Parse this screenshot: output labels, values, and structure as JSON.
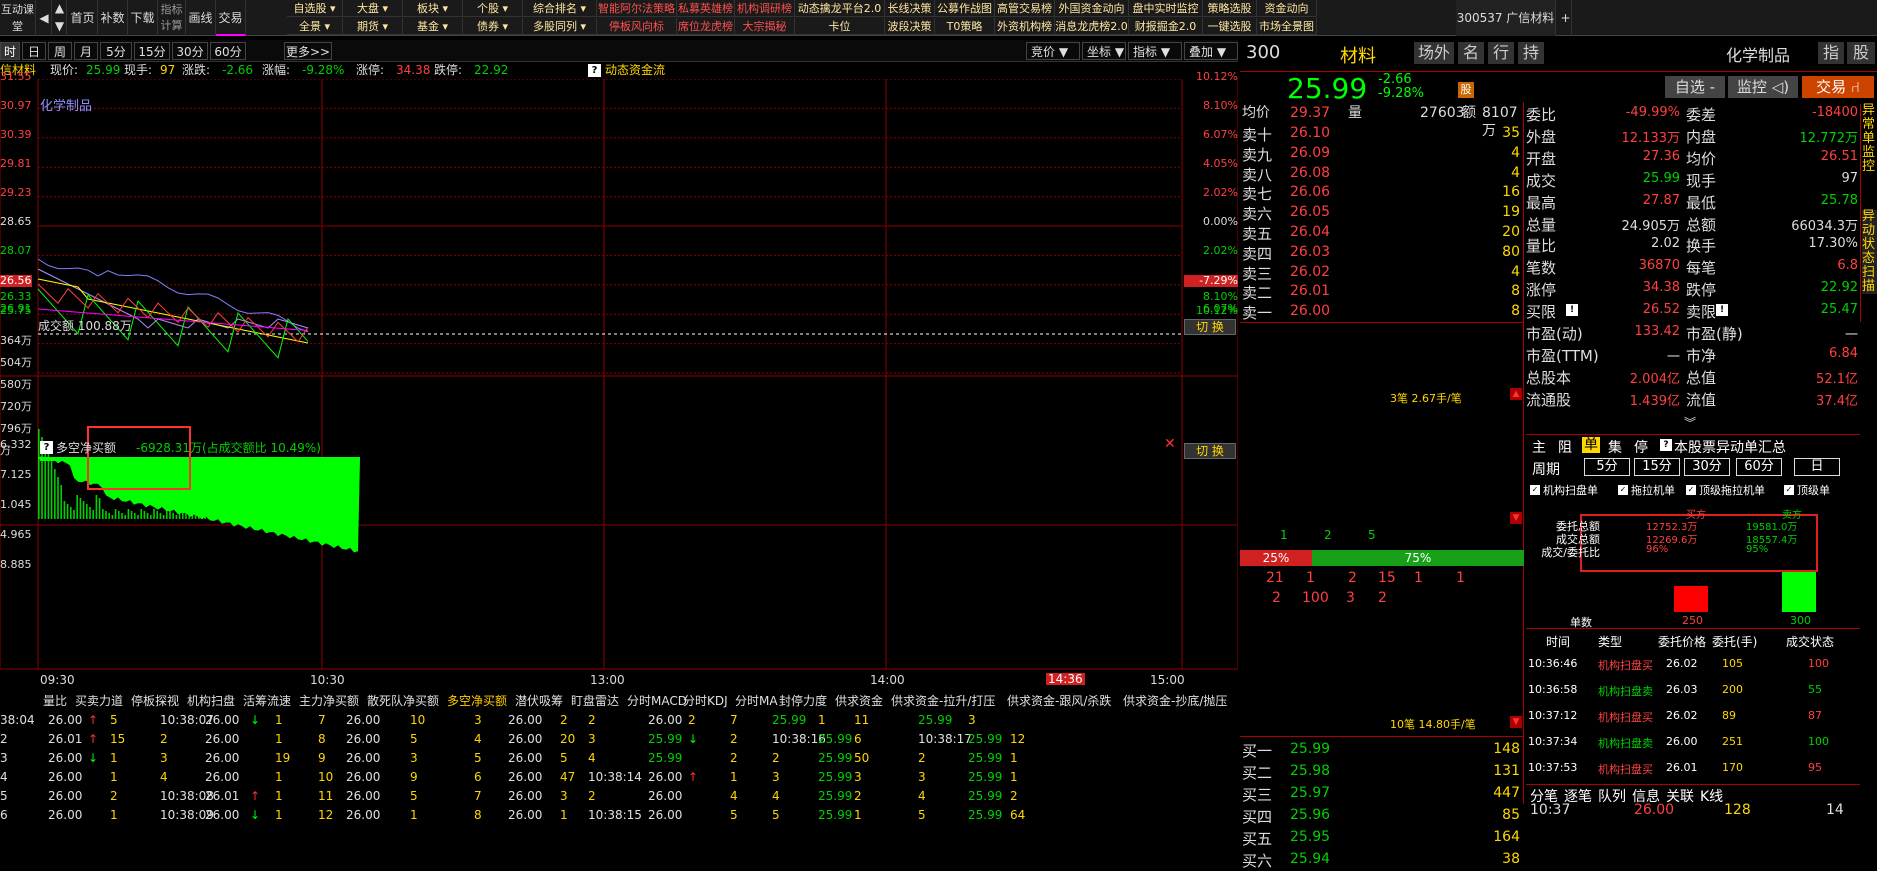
{
  "topbar": {
    "left_buttons": [
      "互动课堂",
      "首页",
      "补数",
      "下载",
      "指标计算",
      "画线",
      "交易"
    ],
    "row1": [
      {
        "t": "自选股",
        "c": "gw"
      },
      {
        "t": "大盘",
        "c": "gw"
      },
      {
        "t": "板块",
        "c": "gw"
      },
      {
        "t": "个股",
        "c": "gw"
      },
      {
        "t": "综合排名",
        "c": "gw"
      },
      {
        "t": "智能阿尔法策略",
        "c": "gr"
      },
      {
        "t": "私募英雄榜",
        "c": "gr"
      },
      {
        "t": "机构调研榜",
        "c": "gr"
      },
      {
        "t": "动态擒龙平台2.0",
        "c": "gw"
      },
      {
        "t": "长线决策",
        "c": "gw"
      },
      {
        "t": "公募作战图",
        "c": "gw"
      },
      {
        "t": "高管交易榜",
        "c": "gw"
      },
      {
        "t": "外国资金动向",
        "c": "gw"
      },
      {
        "t": "盘中实时监控",
        "c": "gw"
      },
      {
        "t": "策略选股",
        "c": "gw"
      },
      {
        "t": "资金动向",
        "c": "gw"
      }
    ],
    "row2": [
      {
        "t": "全景",
        "c": "gw"
      },
      {
        "t": "期货",
        "c": "gw"
      },
      {
        "t": "基金",
        "c": "gw"
      },
      {
        "t": "债券",
        "c": "gw"
      },
      {
        "t": "多股同列",
        "c": "gw"
      },
      {
        "t": "停板风向标",
        "c": "gr"
      },
      {
        "t": "席位龙虎榜",
        "c": "gr"
      },
      {
        "t": "大宗揭秘",
        "c": "gr"
      },
      {
        "t": "卡位",
        "c": "gw"
      },
      {
        "t": "波段决策",
        "c": "gw"
      },
      {
        "t": "T0策略",
        "c": "gw"
      },
      {
        "t": "外资机构榜",
        "c": "gw"
      },
      {
        "t": "消息龙虎榜2.0",
        "c": "gw"
      },
      {
        "t": "财报掘金2.0",
        "c": "gw"
      },
      {
        "t": "一键选股",
        "c": "gw"
      },
      {
        "t": "市场全景图",
        "c": "gw"
      }
    ],
    "tab_label": "300537 广信材料",
    "plus": "+"
  },
  "period": {
    "buttons": [
      "时",
      "日",
      "周",
      "月",
      "5分",
      "15分",
      "30分",
      "60分",
      "更多>>"
    ],
    "right": [
      "竞价",
      "坐标",
      "指标",
      "叠加"
    ]
  },
  "infobar": {
    "name": "信材料",
    "price_label": "现价:",
    "price": "25.99",
    "vol_label": "现手:",
    "vol": "97",
    "chg_label": "涨跌:",
    "chg": "-2.66",
    "pct_label": "涨幅:",
    "pct": "-9.28%",
    "limup_label": "涨停:",
    "limup": "34.38",
    "limdn_label": "跌停:",
    "limdn": "22.92",
    "flow": "动态资金流"
  },
  "chart": {
    "left_prices": [
      "31.55",
      "30.97",
      "30.39",
      "29.81",
      "29.23",
      "28.65",
      "28.07",
      "27.49",
      "26.91",
      "26.56",
      "26.33",
      "25.75"
    ],
    "right_pcts": [
      "10.12%",
      "8.10%",
      "6.07%",
      "4.05%",
      "2.02%",
      "0.00%",
      "2.02%",
      "4.05%",
      "6.07%",
      "-7.29%",
      "8.10%",
      "10.12%"
    ],
    "sector": "化学制品",
    "vol_title": "成交额 100.88万",
    "vol_left": [
      "364万",
      "504万",
      "580万",
      "720万",
      "796万",
      "万"
    ],
    "net_title": "多空净买额",
    "net_value": "-6928.31万(占成交额比 10.49%)",
    "net_left": [
      "6.332",
      "7.125",
      "1.045",
      "4.965",
      "8.885"
    ],
    "switch": "切 换",
    "times": [
      "09:30",
      "10:30",
      "13:00",
      "14:00",
      "15:00"
    ],
    "cur_time": "14:36",
    "colors": {
      "up": "#ff3030",
      "down": "#00ff00",
      "grid": "#8b0000"
    }
  },
  "right": {
    "code": "300",
    "name": "材料",
    "tags": [
      "场外",
      "名",
      "行",
      "持"
    ],
    "sector": "化学制品",
    "sector_tags": [
      "指",
      "股"
    ],
    "price": "25.99",
    "chg": "-2.66",
    "pct": "-9.28%",
    "badge": "股",
    "btns": [
      "自选 -",
      "监控 ◁)",
      "交易 ⑁"
    ],
    "avg_label": "均价",
    "avg": "29.37",
    "vol_label": "量",
    "vol": "27603",
    "amt_label": "额",
    "amt": "8107万",
    "asks": [
      {
        "l": "卖十",
        "p": "26.10",
        "v": "35"
      },
      {
        "l": "卖九",
        "p": "26.09",
        "v": "4"
      },
      {
        "l": "卖八",
        "p": "26.08",
        "v": "4"
      },
      {
        "l": "卖七",
        "p": "26.06",
        "v": "16"
      },
      {
        "l": "卖六",
        "p": "26.05",
        "v": "19"
      },
      {
        "l": "卖五",
        "p": "26.04",
        "v": "20"
      },
      {
        "l": "卖四",
        "p": "26.03",
        "v": "80"
      },
      {
        "l": "卖三",
        "p": "26.02",
        "v": "4"
      },
      {
        "l": "卖二",
        "p": "26.01",
        "v": "8"
      },
      {
        "l": "卖一",
        "p": "26.00",
        "v": "8"
      }
    ],
    "bids": [
      {
        "l": "买一",
        "p": "25.99",
        "v": "148"
      },
      {
        "l": "买二",
        "p": "25.98",
        "v": "131"
      },
      {
        "l": "买三",
        "p": "25.97",
        "v": "447"
      },
      {
        "l": "买四",
        "p": "25.96",
        "v": "85"
      },
      {
        "l": "买五",
        "p": "25.95",
        "v": "164"
      },
      {
        "l": "买六",
        "p": "25.94",
        "v": "38"
      }
    ],
    "ask_summary": "3笔 2.67手/笔",
    "bid_summary": "10笔 14.80手/笔",
    "queue_nums": [
      "1",
      "2",
      "5"
    ],
    "bar_left": "25%",
    "bar_right": "75%",
    "q_row1": [
      "21",
      "1",
      "2",
      "15",
      "1",
      "1"
    ],
    "q_row2": [
      "2",
      "100",
      "3",
      "2"
    ],
    "stats": [
      [
        "委比",
        "-49.99%",
        "r",
        "委差",
        "-18400",
        "r"
      ],
      [
        "外盘",
        "12.133万",
        "r",
        "内盘",
        "12.772万",
        "g"
      ],
      [
        "开盘",
        "27.36",
        "r",
        "均价",
        "26.51",
        "r"
      ],
      [
        "成交",
        "25.99",
        "g",
        "现手",
        "97",
        "w"
      ],
      [
        "最高",
        "27.87",
        "r",
        "最低",
        "25.78",
        "g"
      ],
      [
        "总量",
        "24.905万",
        "w",
        "总额",
        "66034.3万",
        "w"
      ],
      [
        "量比",
        "2.02",
        "w",
        "换手",
        "17.30%",
        "w"
      ],
      [
        "笔数",
        "36870",
        "r",
        "每笔",
        "6.8",
        "r"
      ],
      [
        "涨停",
        "34.38",
        "r",
        "跌停",
        "22.92",
        "g"
      ],
      [
        "买限",
        "26.52",
        "r",
        "卖限",
        "25.47",
        "g"
      ],
      [
        "市盈(动)",
        "133.42",
        "r",
        "市盈(静)",
        "一",
        "w"
      ],
      [
        "市盈(TTM)",
        "一",
        "w",
        "市净",
        "6.84",
        "r"
      ],
      [
        "总股本",
        "2.004亿",
        "r",
        "总值",
        "52.1亿",
        "r"
      ],
      [
        "流通股",
        "1.439亿",
        "r",
        "流值",
        "37.4亿",
        "r"
      ]
    ],
    "vertical_tabs": [
      "异常单监控",
      "异动状态扫描"
    ],
    "main_tabs": [
      "主",
      "阻",
      "单",
      "集",
      "停"
    ],
    "anomaly_title": "本股票异动单汇总",
    "period_label": "周期",
    "periods": [
      "5分",
      "15分",
      "30分",
      "60分",
      "日"
    ],
    "checks": [
      "机构扫盘单",
      "拖拉机单",
      "顶级拖拉机单",
      "顶级单"
    ],
    "summary_head": [
      "买方",
      "卖方"
    ],
    "summary_rows": [
      [
        "委托总额",
        "12752.3万",
        "19581.0万"
      ],
      [
        "成交总额",
        "12269.6万",
        "18557.4万"
      ],
      [
        "成交/委托比",
        "96%",
        "95%"
      ]
    ],
    "count_label": "单数",
    "count_buy": "250",
    "count_sell": "300",
    "tbl_head": [
      "时间",
      "类型",
      "委托价格",
      "委托(手)",
      "成交状态"
    ],
    "tbl_rows": [
      [
        "10:36:46",
        "机构扫盘买",
        "26.02",
        "105",
        "100"
      ],
      [
        "10:36:58",
        "机构扫盘卖",
        "26.03",
        "200",
        "55"
      ],
      [
        "10:37:12",
        "机构扫盘买",
        "26.02",
        "89",
        "87"
      ],
      [
        "10:37:34",
        "机构扫盘卖",
        "26.00",
        "251",
        "100"
      ],
      [
        "10:37:53",
        "机构扫盘买",
        "26.01",
        "170",
        "95"
      ]
    ],
    "bottom_tabs": [
      "分笔",
      "逐笔",
      "队列",
      "信息",
      "关联",
      "K线"
    ],
    "last_tick": [
      "10:37",
      "26.00",
      "128",
      "14"
    ]
  },
  "bottom": {
    "headers": [
      "量比",
      "买卖力道",
      "停板探视",
      "机构扫盘",
      "活筹流速",
      "主力净买额",
      "散死队净买额",
      "多空净买额",
      "潜伏吸筹",
      "盯盘雷达",
      "分时MACD",
      "分时KDJ",
      "分时MA",
      "封停力度",
      "供求资金",
      "供求资金-拉升/打压",
      "供求资金-跟风/杀跌",
      "供求资金-抄底/抛压"
    ],
    "rows": [
      [
        "38:04",
        "26.00",
        "↑",
        "5",
        "10:38:07",
        "26.00",
        "↓",
        "1",
        "7",
        "26.00",
        "10",
        "3",
        "26.00",
        "2",
        "2",
        "26.00",
        "2",
        "7",
        "25.99",
        "1",
        "11",
        "25.99",
        "3"
      ],
      [
        "2",
        "26.01",
        "↑",
        "15",
        "2",
        "26.00",
        "",
        "1",
        "8",
        "26.00",
        "5",
        "4",
        "26.00",
        "20",
        "3",
        "25.99",
        "↓",
        "2",
        "10:38:16",
        "25.99",
        "6",
        "10:38:17",
        "25.99",
        "12"
      ],
      [
        "3",
        "26.00",
        "↓",
        "1",
        "3",
        "26.00",
        "",
        "19",
        "9",
        "26.00",
        "3",
        "5",
        "26.00",
        "5",
        "4",
        "25.99",
        "",
        "2",
        "2",
        "25.99",
        "50",
        "2",
        "25.99",
        "1"
      ],
      [
        "4",
        "26.00",
        "",
        "1",
        "4",
        "26.00",
        "",
        "1",
        "10",
        "26.00",
        "9",
        "6",
        "26.00",
        "47",
        "10:38:14",
        "26.00",
        "↑",
        "1",
        "3",
        "25.99",
        "3",
        "3",
        "25.99",
        "1"
      ],
      [
        "5",
        "26.00",
        "",
        "2",
        "10:38:08",
        "26.01",
        "↑",
        "1",
        "11",
        "26.00",
        "5",
        "7",
        "26.00",
        "3",
        "2",
        "26.00",
        "",
        "4",
        "4",
        "25.99",
        "2",
        "4",
        "25.99",
        "2"
      ],
      [
        "6",
        "26.00",
        "",
        "1",
        "10:38:09",
        "26.00",
        "↓",
        "1",
        "12",
        "26.00",
        "1",
        "8",
        "26.00",
        "1",
        "10:38:15",
        "26.00",
        "",
        "5",
        "5",
        "25.99",
        "1",
        "5",
        "25.99",
        "64"
      ]
    ]
  }
}
